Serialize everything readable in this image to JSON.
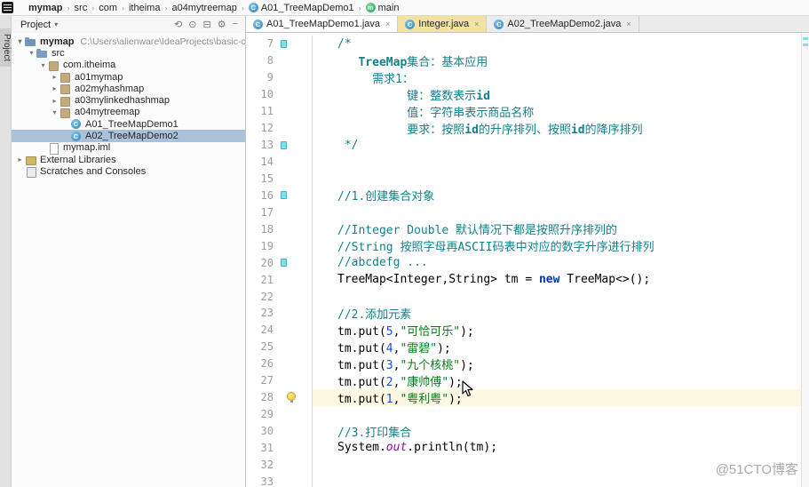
{
  "window": {
    "watermark": "@51CTO博客"
  },
  "colors": {
    "comment": "#14808a",
    "string": "#067d17",
    "keyword": "#0033b3",
    "number": "#1750eb",
    "field": "#871094",
    "selection": "#a9c2d9",
    "readonly_tab": "#f3e3a1",
    "change_marker": "#8adbe8"
  },
  "tool_strip": {
    "project_tab": "Project"
  },
  "breadcrumbs": {
    "separator": "›",
    "items": [
      {
        "label": "mymap",
        "bold": true
      },
      {
        "label": "src"
      },
      {
        "label": "com"
      },
      {
        "label": "itheima"
      },
      {
        "label": "a04mytreemap"
      },
      {
        "label": "A01_TreeMapDemo1",
        "icon": "class-icon",
        "icon_text": "C"
      },
      {
        "label": "main",
        "icon": "method-icon",
        "icon_text": "m"
      }
    ]
  },
  "project_panel": {
    "title": "Project",
    "caret_glyph": "▾",
    "header_icons": [
      {
        "name": "sync-icon",
        "glyph": "⟲"
      },
      {
        "name": "select-opened-file-icon",
        "glyph": "⊙"
      },
      {
        "name": "collapse-all-icon",
        "glyph": "⊟"
      },
      {
        "name": "settings-icon",
        "glyph": "⚙"
      },
      {
        "name": "hide-panel-icon",
        "glyph": "−"
      }
    ],
    "tree": [
      {
        "level": 0,
        "chevron": "v",
        "icon": "folder-project-icon",
        "label": "mymap",
        "bold": true,
        "hint": "C:\\Users\\alienware\\IdeaProjects\\basic-code\\..."
      },
      {
        "level": 1,
        "chevron": "v",
        "icon": "folder-icon",
        "label": "src"
      },
      {
        "level": 2,
        "chevron": "v",
        "icon": "package-icon",
        "label": "com.itheima"
      },
      {
        "level": 3,
        "chevron": ">",
        "icon": "package-icon",
        "label": "a01mymap"
      },
      {
        "level": 3,
        "chevron": ">",
        "icon": "package-icon",
        "label": "a02myhashmap"
      },
      {
        "level": 3,
        "chevron": ">",
        "icon": "package-icon",
        "label": "a03mylinkedhashmap"
      },
      {
        "level": 3,
        "chevron": "v",
        "icon": "package-icon",
        "label": "a04mytreemap"
      },
      {
        "level": 4,
        "chevron": "",
        "icon": "class-icon",
        "icon_text": "C",
        "label": "A01_TreeMapDemo1"
      },
      {
        "level": 4,
        "chevron": "",
        "icon": "class-icon",
        "icon_text": "C",
        "label": "A02_TreeMapDemo2",
        "selected": true
      },
      {
        "level": 2,
        "chevron": "",
        "icon": "file-icon",
        "label": "mymap.iml"
      },
      {
        "level": 0,
        "chevron": ">",
        "icon": "lib-icon",
        "label": "External Libraries"
      },
      {
        "level": 0,
        "chevron": "",
        "icon": "scratch-icon",
        "label": "Scratches and Consoles"
      }
    ]
  },
  "editor": {
    "close_glyph": "×",
    "tabs": [
      {
        "label": "A01_TreeMapDemo1.java",
        "state": "active",
        "icon_text": "C"
      },
      {
        "label": "Integer.java",
        "state": "readonly",
        "icon_text": "C"
      },
      {
        "label": "A02_TreeMapDemo2.java",
        "state": "normal",
        "icon_text": "C"
      }
    ],
    "current_line": 28,
    "lines": [
      {
        "n": 7,
        "mark": "fold",
        "seg": [
          [
            "cmt",
            "/*"
          ]
        ]
      },
      {
        "n": 8,
        "seg": [
          [
            "cmt",
            "   "
          ],
          [
            "cmt-b",
            "TreeMap"
          ],
          [
            "cmt",
            "集合：基本应用"
          ]
        ]
      },
      {
        "n": 9,
        "seg": [
          [
            "cmt",
            "     需求1："
          ]
        ]
      },
      {
        "n": 10,
        "seg": [
          [
            "cmt",
            "          键：整数表示"
          ],
          [
            "cmt-b",
            "id"
          ]
        ]
      },
      {
        "n": 11,
        "seg": [
          [
            "cmt",
            "          值：字符串表示商品名称"
          ]
        ]
      },
      {
        "n": 12,
        "seg": [
          [
            "cmt",
            "          要求：按照"
          ],
          [
            "cmt-b",
            "id"
          ],
          [
            "cmt",
            "的升序排列、按照"
          ],
          [
            "cmt-b",
            "id"
          ],
          [
            "cmt",
            "的降序排列"
          ]
        ]
      },
      {
        "n": 13,
        "mark": "fold",
        "seg": [
          [
            "cmt",
            " */"
          ]
        ]
      },
      {
        "n": 14,
        "seg": []
      },
      {
        "n": 15,
        "seg": []
      },
      {
        "n": 16,
        "mark": "fold",
        "seg": [
          [
            "cmt",
            "//1.创建集合对象"
          ]
        ]
      },
      {
        "n": 17,
        "seg": []
      },
      {
        "n": 18,
        "seg": [
          [
            "cmt",
            "//Integer Double 默认情况下都是按照升序排列的"
          ]
        ]
      },
      {
        "n": 19,
        "seg": [
          [
            "cmt",
            "//String 按照字母再ASCII码表中对应的数字升序进行排列"
          ]
        ]
      },
      {
        "n": 20,
        "mark": "fold",
        "seg": [
          [
            "cmt",
            "//abcdefg ..."
          ]
        ]
      },
      {
        "n": 21,
        "seg": [
          [
            "plain",
            "TreeMap<Integer,String> tm = "
          ],
          [
            "kw",
            "new"
          ],
          [
            "plain",
            " TreeMap<>();"
          ]
        ]
      },
      {
        "n": 22,
        "seg": []
      },
      {
        "n": 23,
        "seg": [
          [
            "cmt",
            "//2.添加元素"
          ]
        ]
      },
      {
        "n": 24,
        "seg": [
          [
            "plain",
            "tm.put("
          ],
          [
            "num",
            "5"
          ],
          [
            "plain",
            ","
          ],
          [
            "str",
            "\"可恰可乐\""
          ],
          [
            "plain",
            ");"
          ]
        ]
      },
      {
        "n": 25,
        "seg": [
          [
            "plain",
            "tm.put("
          ],
          [
            "num",
            "4"
          ],
          [
            "plain",
            ","
          ],
          [
            "str",
            "\"雷碧\""
          ],
          [
            "plain",
            ");"
          ]
        ]
      },
      {
        "n": 26,
        "seg": [
          [
            "plain",
            "tm.put("
          ],
          [
            "num",
            "3"
          ],
          [
            "plain",
            ","
          ],
          [
            "str",
            "\"九个核桃\""
          ],
          [
            "plain",
            ");"
          ]
        ]
      },
      {
        "n": 27,
        "seg": [
          [
            "plain",
            "tm.put("
          ],
          [
            "num",
            "2"
          ],
          [
            "plain",
            ","
          ],
          [
            "str",
            "\"康帅傅\""
          ],
          [
            "plain",
            ");"
          ]
        ]
      },
      {
        "n": 28,
        "mark": "bulb",
        "current": true,
        "seg": [
          [
            "plain",
            "tm.put("
          ],
          [
            "num",
            "1"
          ],
          [
            "plain",
            ","
          ],
          [
            "str",
            "\"粤利粤\""
          ],
          [
            "plain",
            ");"
          ]
        ]
      },
      {
        "n": 29,
        "seg": []
      },
      {
        "n": 30,
        "seg": [
          [
            "cmt",
            "//3.打印集合"
          ]
        ]
      },
      {
        "n": 31,
        "seg": [
          [
            "plain",
            "System."
          ],
          [
            "field",
            "out"
          ],
          [
            "plain",
            ".println(tm);"
          ]
        ]
      },
      {
        "n": 32,
        "seg": []
      },
      {
        "n": 33,
        "seg": []
      }
    ]
  }
}
